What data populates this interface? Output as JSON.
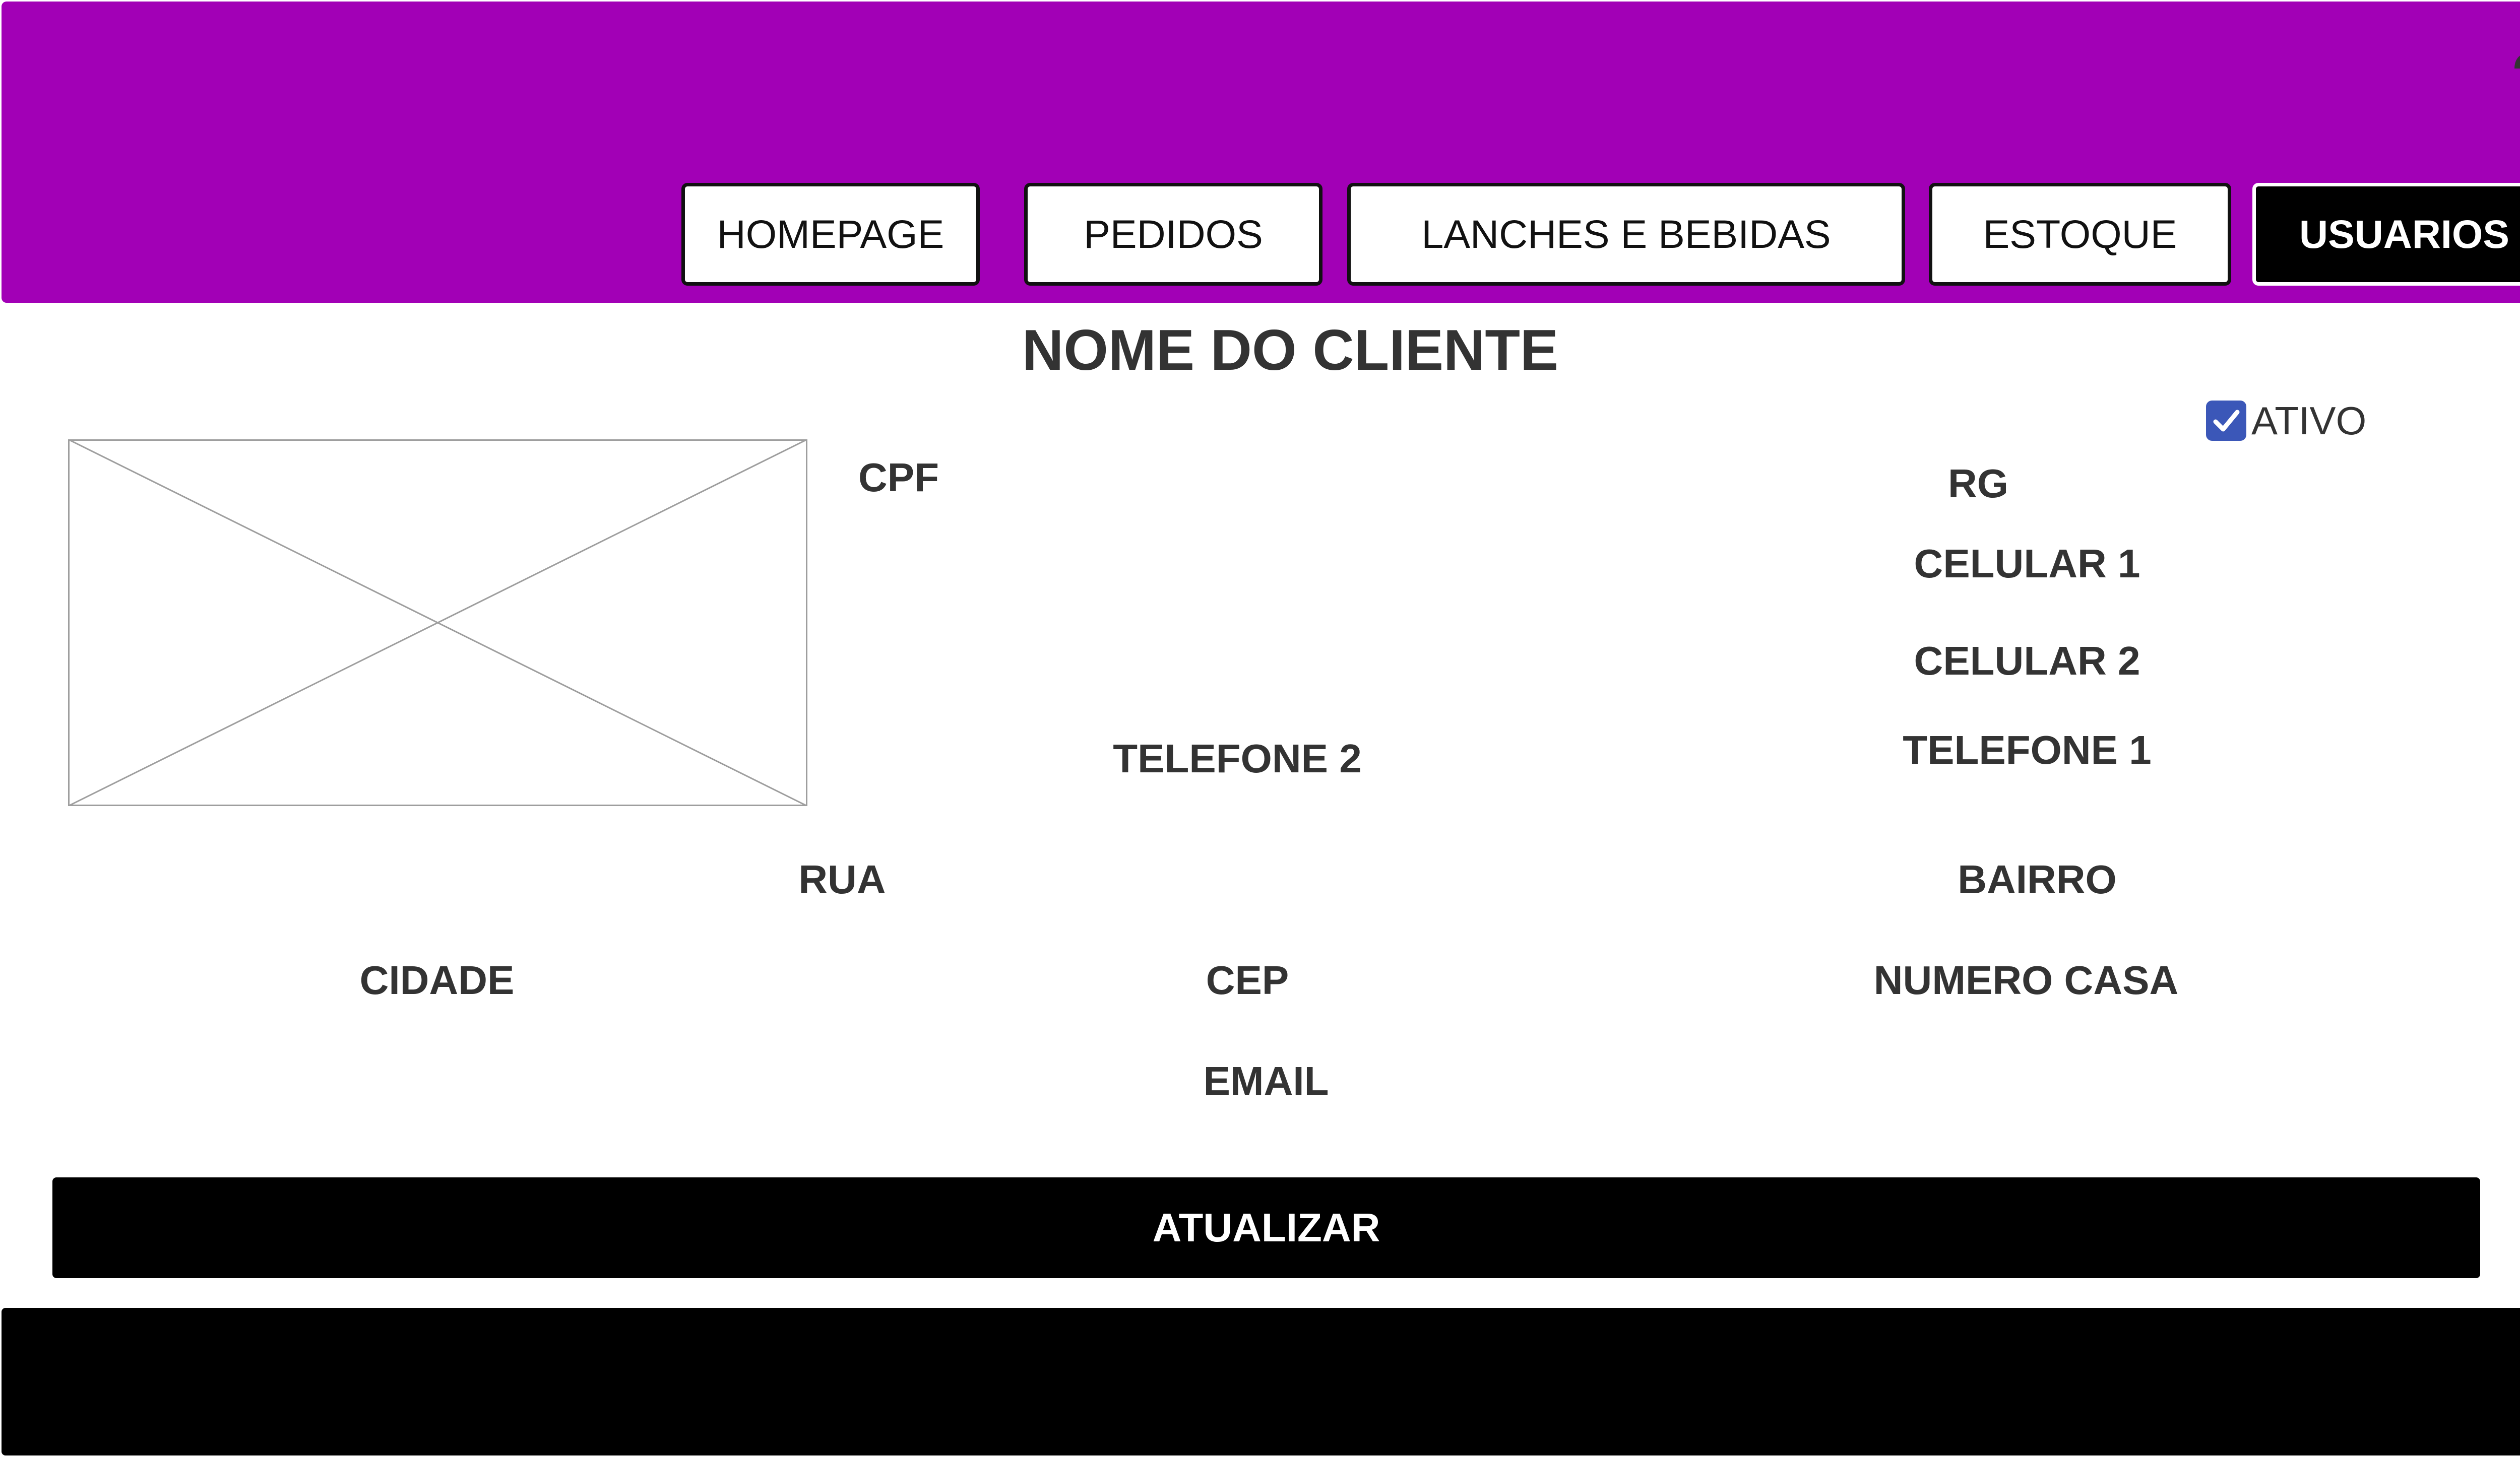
{
  "colors": {
    "header_bg": "#a200b6",
    "active_tab_bg": "#000000",
    "checkbox": "#3b57b8",
    "footer_bg": "#000000"
  },
  "header": {
    "user_icon": "user-menu-icon",
    "nav": [
      {
        "label": "HOMEPAGE",
        "active": false
      },
      {
        "label": "PEDIDOS",
        "active": false
      },
      {
        "label": "LANCHES E BEBIDAS",
        "active": false
      },
      {
        "label": "ESTOQUE",
        "active": false
      },
      {
        "label": "USUARIOS",
        "active": true
      }
    ]
  },
  "main": {
    "title": "NOME DO CLIENTE",
    "active_checkbox": {
      "label": "ATIVO",
      "checked": true
    },
    "image_placeholder": "image-placeholder-icon",
    "fields": {
      "cpf": "CPF",
      "rg": "RG",
      "celular1": "CELULAR 1",
      "celular2": "CELULAR 2",
      "telefone1": "TELEFONE 1",
      "telefone2": "TELEFONE 2",
      "rua": "RUA",
      "bairro": "BAIRRO",
      "cidade": "CIDADE",
      "cep": "CEP",
      "numero_casa": "NUMERO CASA",
      "email": "EMAIL"
    },
    "update_button": "ATUALIZAR"
  }
}
